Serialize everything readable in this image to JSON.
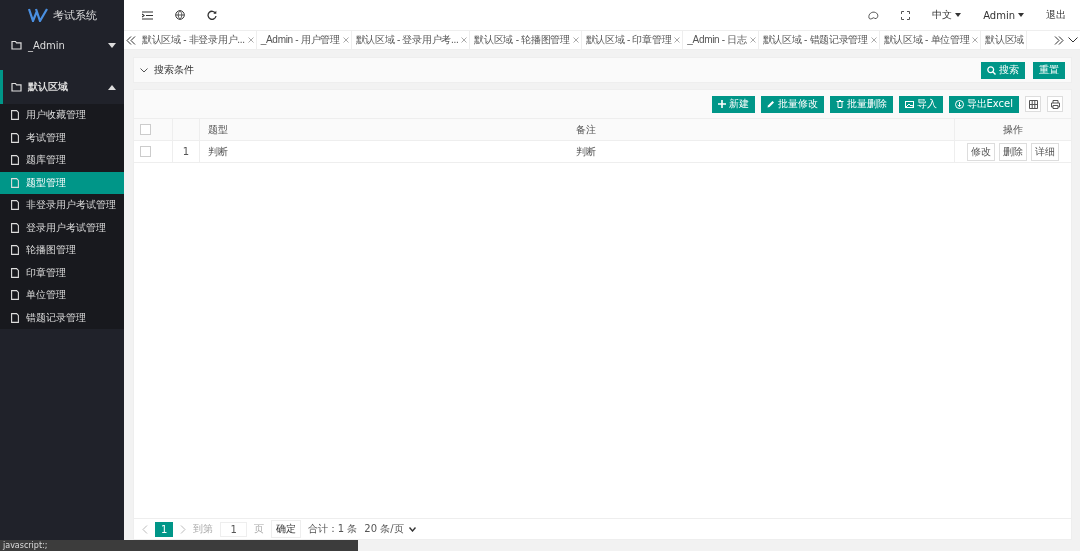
{
  "app": {
    "title": "考试系统"
  },
  "sidebar": {
    "groups": [
      {
        "label": "_Admin",
        "expanded": false
      },
      {
        "label": "默认区域",
        "expanded": true,
        "children": [
          {
            "label": "用户收藏管理",
            "selected": false
          },
          {
            "label": "考试管理",
            "selected": false
          },
          {
            "label": "题库管理",
            "selected": false
          },
          {
            "label": "题型管理",
            "selected": true
          },
          {
            "label": "非登录用户考试管理",
            "selected": false
          },
          {
            "label": "登录用户考试管理",
            "selected": false
          },
          {
            "label": "轮播图管理",
            "selected": false
          },
          {
            "label": "印章管理",
            "selected": false
          },
          {
            "label": "单位管理",
            "selected": false
          },
          {
            "label": "错题记录管理",
            "selected": false
          }
        ]
      }
    ]
  },
  "header": {
    "language": "中文",
    "user": "Admin",
    "logout": "退出"
  },
  "tabs": [
    {
      "label": "默认区域 - 非登录用户...",
      "selected": false
    },
    {
      "label": "_Admin - 用户管理",
      "selected": false
    },
    {
      "label": "默认区域 - 登录用户考...",
      "selected": false
    },
    {
      "label": "默认区域 - 轮播图管理",
      "selected": false
    },
    {
      "label": "默认区域 - 印章管理",
      "selected": false
    },
    {
      "label": "_Admin - 日志",
      "selected": false
    },
    {
      "label": "默认区域 - 错题记录管理",
      "selected": false
    },
    {
      "label": "默认区域 - 单位管理",
      "selected": false
    },
    {
      "label": "默认区域",
      "selected": false
    }
  ],
  "search_panel": {
    "title": "搜索条件",
    "buttons": [
      "搜索",
      "重置"
    ]
  },
  "toolbar": {
    "buttons": [
      {
        "label": "新建",
        "kind": "plus"
      },
      {
        "label": "批量修改",
        "kind": "pencil"
      },
      {
        "label": "批量删除",
        "kind": "trash"
      },
      {
        "label": "导入",
        "kind": "import"
      },
      {
        "label": "导出Excel",
        "kind": "export"
      }
    ]
  },
  "table": {
    "all_checked": false,
    "columns": [
      "题型",
      "备注",
      "操作"
    ],
    "rows": [
      {
        "index": "1",
        "checked": false,
        "type": "判断",
        "note": "判断",
        "actions": [
          "修改",
          "删除",
          "详细"
        ]
      }
    ]
  },
  "pagination": {
    "current": "1",
    "goto_label": "到第",
    "goto_value": "1",
    "page_unit": "页",
    "confirm": "确定",
    "total": "合计：1 条",
    "page_size": "20 条/页"
  },
  "status_bar": {
    "text": "javascript:;"
  }
}
